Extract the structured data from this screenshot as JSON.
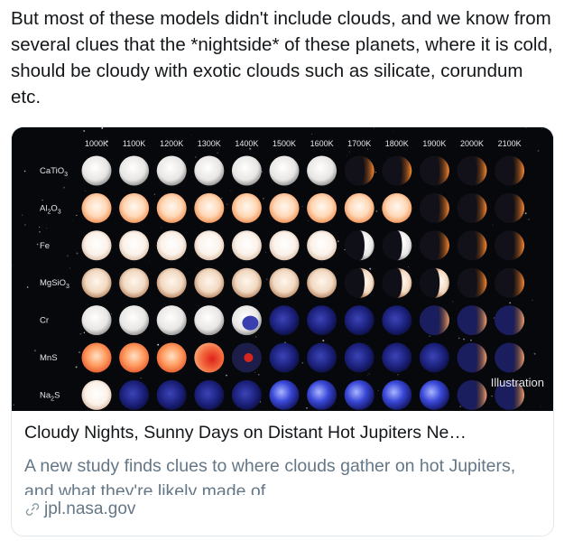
{
  "tweet": {
    "text": "But most of these models didn't include clouds, and we know from several clues that the *nightside* of these planets, where it is cold, should be cloudy with exotic clouds such as silicate, corundum etc."
  },
  "card": {
    "image": {
      "temperatures": [
        "1000K",
        "1100K",
        "1200K",
        "1300K",
        "1400K",
        "1500K",
        "1600K",
        "1700K",
        "1800K",
        "1900K",
        "2000K",
        "2100K"
      ],
      "species": [
        {
          "base": "CaTiO",
          "sub": "3",
          "after": ""
        },
        {
          "base": "Al",
          "sub": "2",
          "after": "O",
          "sub2": "3"
        },
        {
          "base": "Fe",
          "sub": "",
          "after": ""
        },
        {
          "base": "MgSiO",
          "sub": "3",
          "after": ""
        },
        {
          "base": "Cr",
          "sub": "",
          "after": ""
        },
        {
          "base": "MnS",
          "sub": "",
          "after": ""
        },
        {
          "base": "Na",
          "sub": "2",
          "after": "S"
        }
      ],
      "watermark": "Illustration"
    },
    "title": "Cloudy Nights, Sunny Days on Distant Hot Jupiters Ne…",
    "description": "A new study finds clues to where clouds gather on hot Jupiters, and what they're likely made of",
    "domain": "jpl.nasa.gov",
    "domain_icon": "link-icon"
  }
}
